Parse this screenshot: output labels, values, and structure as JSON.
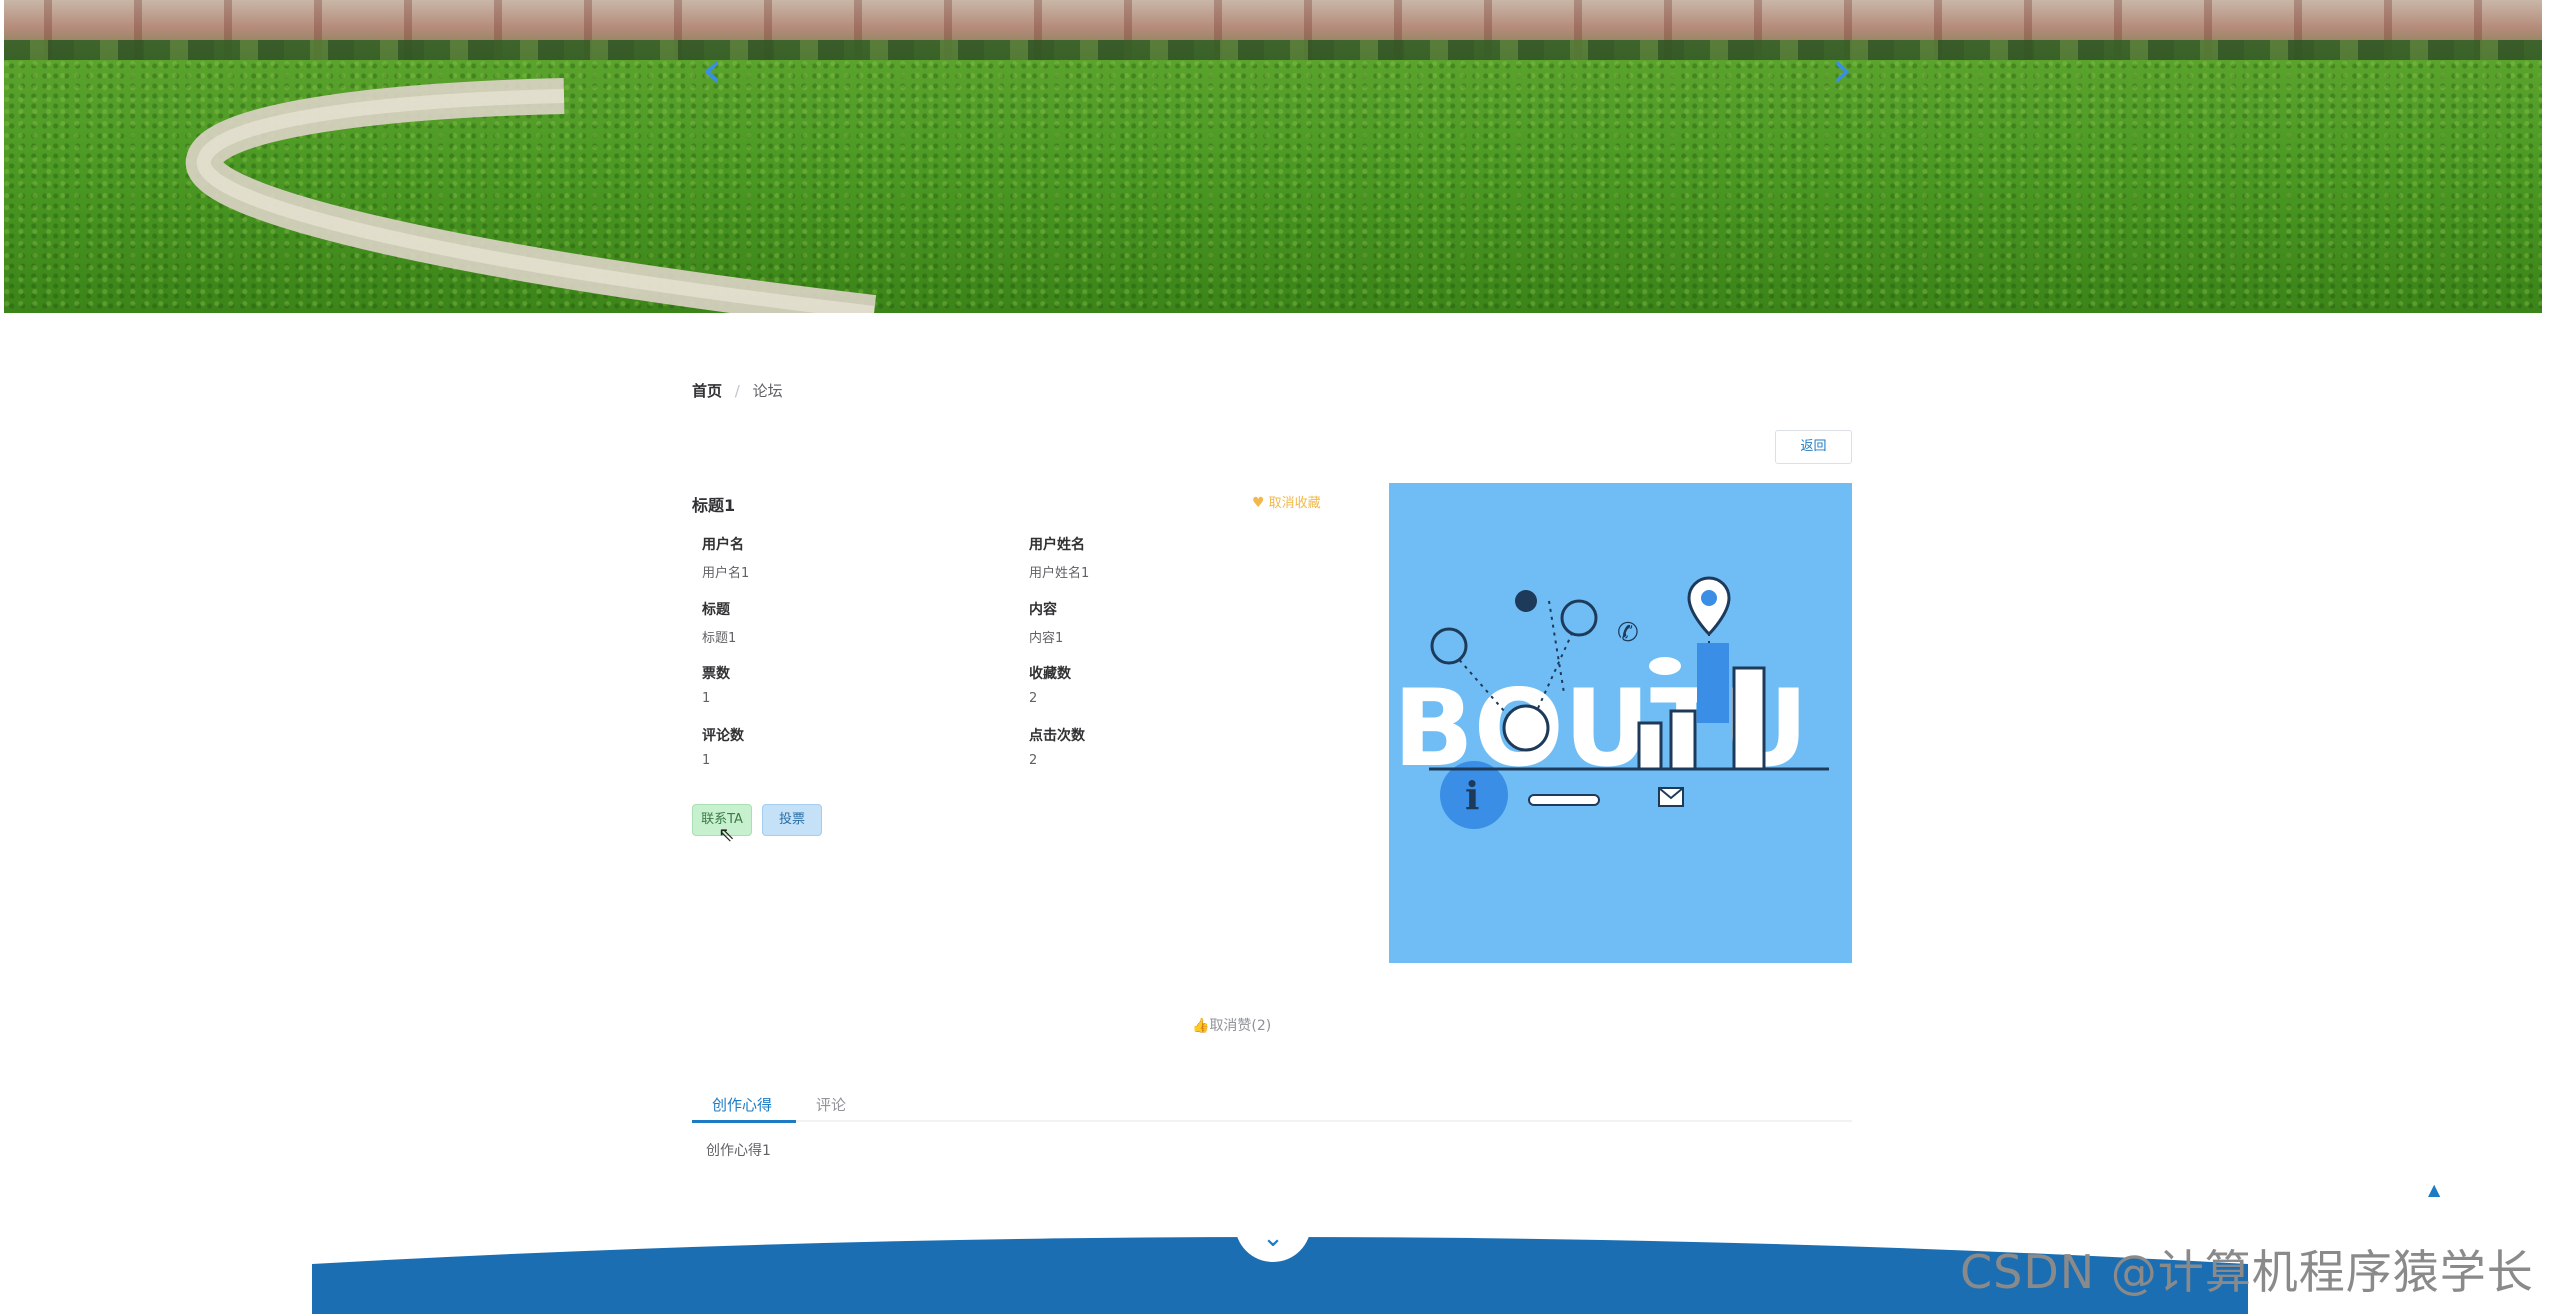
{
  "banner": {
    "prev_icon": "‹",
    "next_icon": "›"
  },
  "breadcrumb": {
    "home": "首页",
    "separator": "/",
    "current": "论坛"
  },
  "actions": {
    "back_label": "返回"
  },
  "detail": {
    "title": "标题1",
    "favorite_label": "取消收藏",
    "fields": [
      {
        "label": "用户名",
        "value": "用户名1"
      },
      {
        "label": "用户姓名",
        "value": "用户姓名1"
      },
      {
        "label": "标题",
        "value": "标题1"
      },
      {
        "label": "内容",
        "value": "内容1"
      },
      {
        "label": "票数",
        "value": "1"
      },
      {
        "label": "收藏数",
        "value": "2"
      },
      {
        "label": "评论数",
        "value": "1"
      },
      {
        "label": "点击次数",
        "value": "2"
      }
    ],
    "contact_label": "联系TA",
    "vote_label": "投票",
    "image_text": "BOUTU"
  },
  "like": {
    "label": "取消赞(2)"
  },
  "tabs": [
    {
      "label": "创作心得"
    },
    {
      "label": "评论"
    }
  ],
  "tab_content": "创作心得1",
  "footer": {
    "watermark": "CSDN @计算机程序猿学长"
  },
  "colors": {
    "primary": "#1d7bc4",
    "image_bg": "#6fbdf4",
    "favorite": "#f2b84b",
    "contact_bg": "#c7f0cf",
    "vote_bg": "#c4e1f8"
  }
}
